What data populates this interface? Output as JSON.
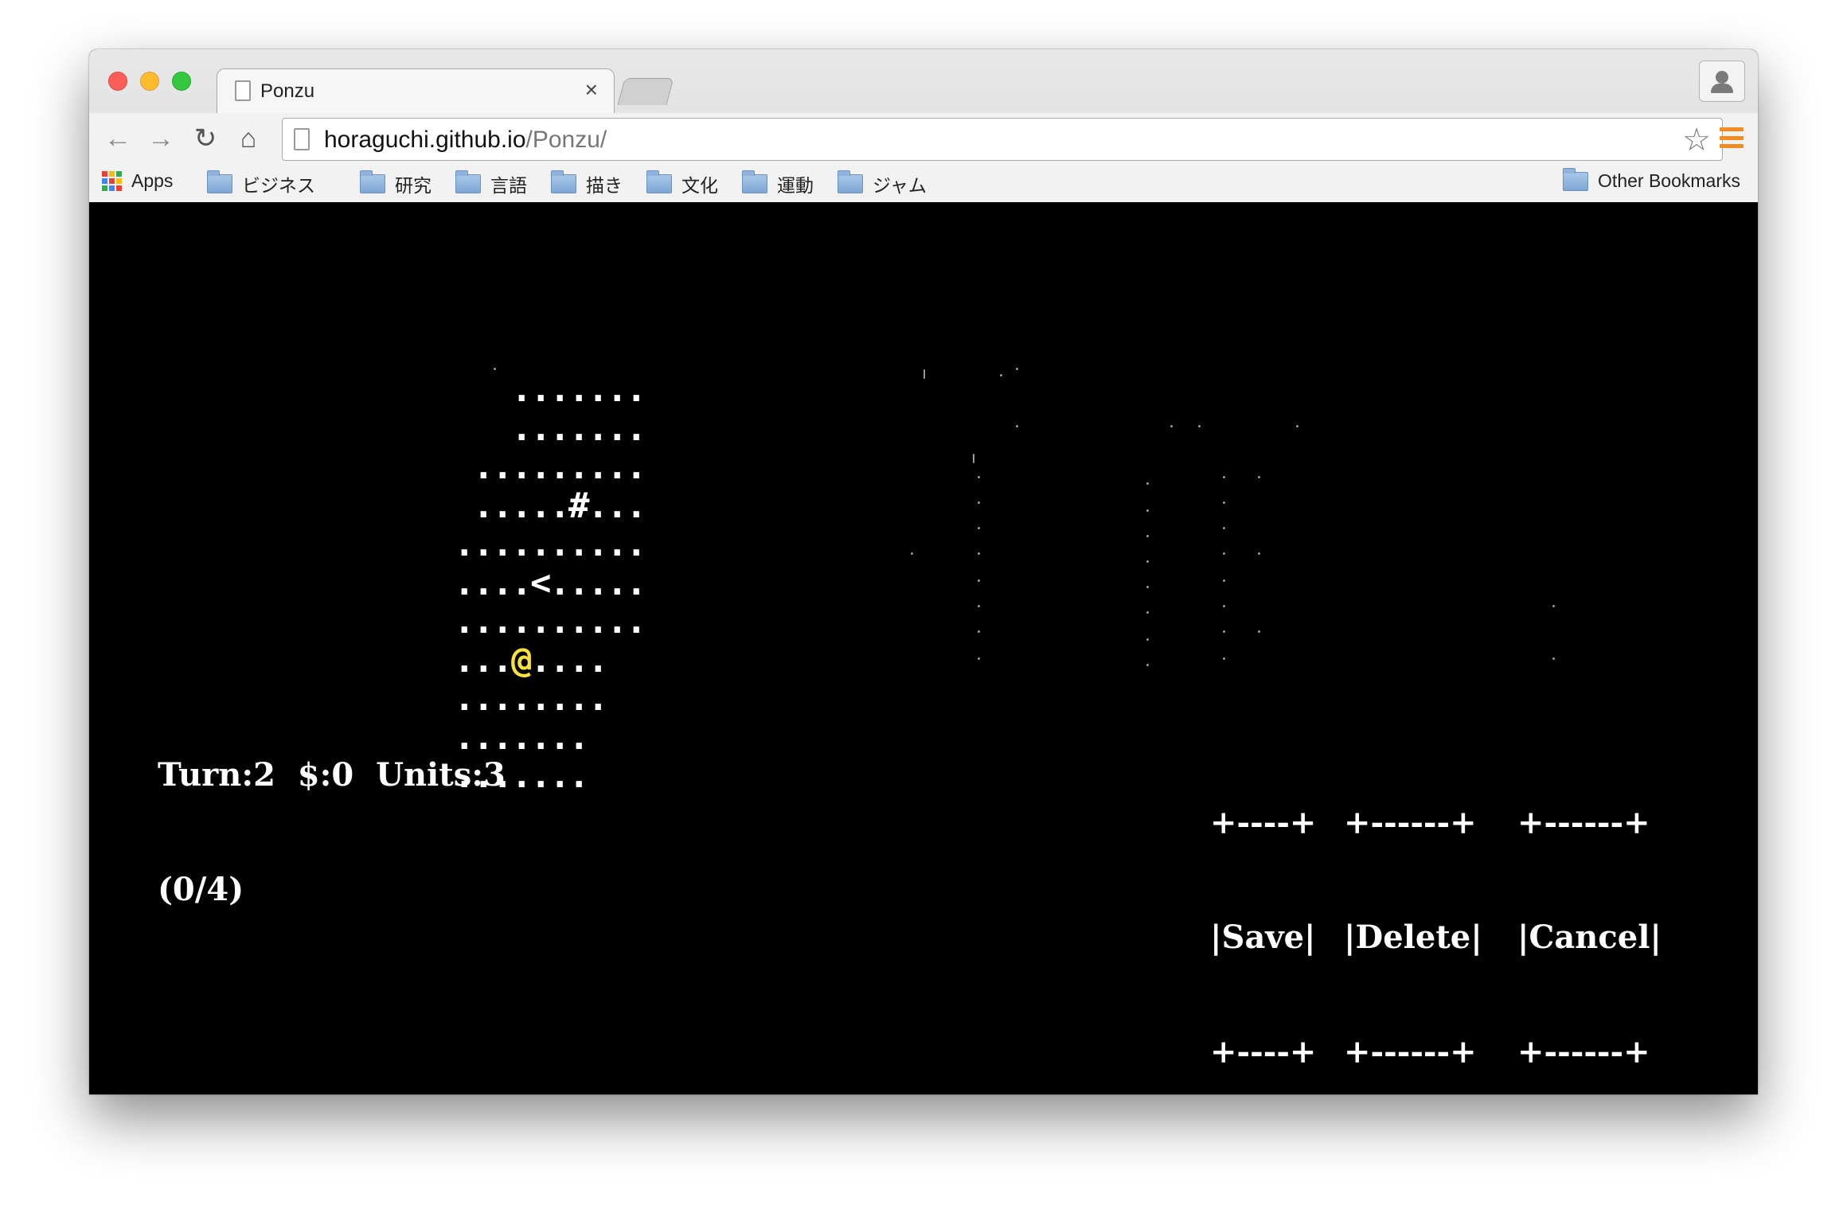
{
  "browser": {
    "tab_title": "Ponzu",
    "tab_close": "×",
    "url_host": "horaguchi.github.io",
    "url_path": "/Ponzu/",
    "bookmarks": [
      {
        "label": "Apps"
      },
      {
        "label": "ビジネス"
      },
      {
        "label": "研究"
      },
      {
        "label": "言語"
      },
      {
        "label": "描き"
      },
      {
        "label": "文化"
      },
      {
        "label": "運動"
      },
      {
        "label": "ジャム"
      }
    ],
    "other_bookmarks": "Other Bookmarks"
  },
  "game": {
    "map_rows": [
      "   .......",
      "   .......",
      " .........",
      " .....#...",
      "..........",
      "....<.....",
      "..........",
      "...@....",
      "........",
      ".......",
      "......."
    ],
    "status_line1": "Turn:2  $:0  Units:3",
    "status_line2": "(0/4)",
    "buttons": [
      {
        "top": "+----+",
        "label": "|Save|",
        "bottom": "+----+"
      },
      {
        "top": "+------+",
        "label": "|Delete|",
        "bottom": "+------+"
      },
      {
        "top": "+------+",
        "label": "|Cancel|",
        "bottom": "+------+"
      }
    ],
    "player_color": "#f7e33a"
  }
}
